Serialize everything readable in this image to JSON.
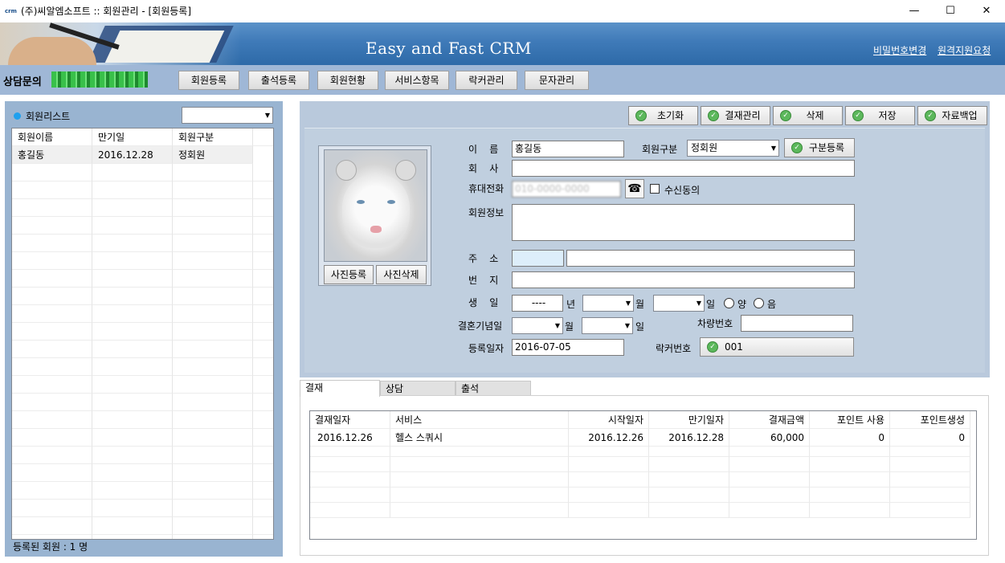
{
  "window": {
    "title": "(주)씨알엠소프트 :: 회원관리 - [회원등록]",
    "app_icon_text": "crm",
    "minimize": "—",
    "maximize": "☐",
    "close": "✕"
  },
  "banner": {
    "slogan": "Easy and Fast CRM",
    "link_password": "비밀번호변경",
    "link_remote": "원격지원요청"
  },
  "menubar": {
    "brand": "상담문의",
    "brand_phone": "1644-0000",
    "items": [
      "회원등록",
      "출석등록",
      "회원현황",
      "서비스항목",
      "락커관리",
      "문자관리"
    ]
  },
  "member_list": {
    "title": "회원리스트",
    "filter_value": "",
    "columns": [
      "회원이름",
      "만기일",
      "회원구분"
    ],
    "rows": [
      [
        "홍길동",
        "2016.12.28",
        "정회원"
      ]
    ],
    "count_text": "등록된 회원 : 1 명"
  },
  "toolbar": {
    "reset": "초기화",
    "payment": "결재관리",
    "delete": "삭제",
    "save": "저장",
    "backup": "자료백업"
  },
  "photo": {
    "register": "사진등록",
    "delete": "사진삭제"
  },
  "form": {
    "name_label": "이    름",
    "name_value": "홍길동",
    "type_label": "회원구분",
    "type_value": "정회원",
    "type_register_btn": "구분등록",
    "company_label": "회    사",
    "company_value": "",
    "phone_label": "휴대전화",
    "phone_value": "010-0000-0000",
    "phone_icon": "☎",
    "sms_agree_label": "수신동의",
    "info_label": "회원정보",
    "info_value": "",
    "address_label": "주    소",
    "zip_value": "",
    "address_value": "",
    "detail_label": "번    지",
    "detail_value": "",
    "birth_label": "생    일",
    "birth_year": "----",
    "year_unit": "년",
    "month_unit": "월",
    "day_unit": "일",
    "solar": "양",
    "lunar": "음",
    "anniv_label": "결혼기념일",
    "car_label": "차량번호",
    "car_value": "",
    "reg_label": "등록일자",
    "reg_value": "2016-07-05",
    "locker_label": "락커번호",
    "locker_value": "001"
  },
  "tabs": [
    "결재",
    "상담",
    "출석"
  ],
  "payments": {
    "columns": [
      "결재일자",
      "서비스",
      "시작일자",
      "만기일자",
      "결재금액",
      "포인트 사용",
      "포인트생성"
    ],
    "rows": [
      [
        "2016.12.26",
        "헬스 스쿼시",
        "2016.12.26",
        "2016.12.28",
        "60,000",
        "0",
        "0"
      ]
    ]
  }
}
